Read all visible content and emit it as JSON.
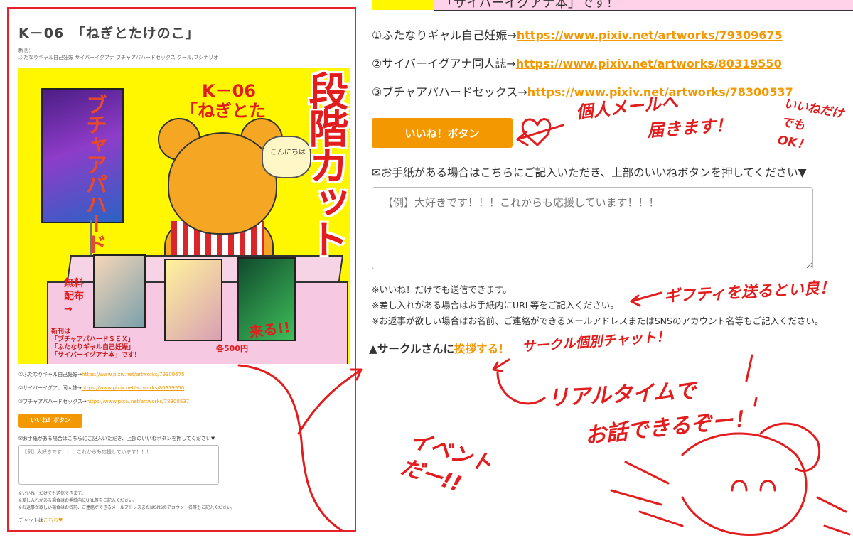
{
  "left_preview": {
    "title": "K－06　「ねぎとたけのこ」",
    "tags_heading": "新刊：",
    "tags": "ふたなりギャル自己妊娠 サイバーイグアナ ブチャアパハードセックス クール/フシナリオ",
    "poster": {
      "title_line1": "K－06",
      "title_line2": "「ねぎとた",
      "banner_text": "ブチャアパハード",
      "bubble_text": "こんにちは",
      "free_label": "無料\n配布\n→",
      "new_label": "新刊は\n「ブチャアパハードＳＥＸ」\n「ふたなりギャル自己妊娠」\n「サイバーイグアナ本」です！",
      "price_label": "各500円",
      "come_label": "来る!!"
    },
    "links": [
      {
        "label": "①ふたなりギャル自己妊娠→",
        "url": "https://www.pixiv.net/artworks/79309675"
      },
      {
        "label": "②サイバーイグアナ同人誌→",
        "url": "https://www.pixiv.net/artworks/80319550"
      },
      {
        "label": "③ブチャアパハードセックス→",
        "url": "https://www.pixiv.net/artworks/78300537"
      }
    ],
    "like_button": "いいね！ボタン",
    "letter_label": "✉お手紙がある場合はこちらにご記入いただき、上部のいいねボタンを押してください▼",
    "textarea_placeholder": "【例】大好きです！！！これからも応援しています！！！",
    "notes": [
      "※いいね！だけでも送信できます。",
      "※差し入れがある場合はお手紙内にURL等をご記入ください。",
      "※お返事が欲しい場合はお名前、ご連絡ができるメールアドレスまたはSNSのアカウント名等もご記入ください。"
    ],
    "chat_prefix": "チャットは",
    "chat_link": "こちら♥"
  },
  "annotation_left": "段階カット",
  "header_strip_text": "「サイバーイグアナ本」です！",
  "links": [
    {
      "label": "①ふたなりギャル自己妊娠→",
      "url": "https://www.pixiv.net/artworks/79309675"
    },
    {
      "label": "②サイバーイグアナ同人誌→",
      "url": "https://www.pixiv.net/artworks/80319550"
    },
    {
      "label": "③ブチャアパハードセックス→",
      "url": "https://www.pixiv.net/artworks/78300537"
    }
  ],
  "like_button": "いいね！ボタン",
  "letter_label": "✉お手紙がある場合はこちらにご記入いただき、上部のいいねボタンを押してください▼",
  "message_placeholder": "【例】大好きです！！！これからも応援しています！！！",
  "notes": [
    "※いいね！だけでも送信できます。",
    "※差し入れがある場合はお手紙内にURL等をご記入ください。",
    "※お返事が欲しい場合はお名前、ご連絡ができるメールアドレスまたはSNSのアカウント名等もご記入ください。"
  ],
  "circle": {
    "prefix": "▲サークルさんに",
    "link": "挨拶する！"
  },
  "annotations": {
    "personal_mail_1": "個人メールへ",
    "personal_mail_2": "届きます！",
    "ok": "いいねだけ\nでも\nOK！",
    "gift": "ギフティを送るとい良！",
    "circle_chat": "サークル個別チャット！",
    "realtime": "リアルタイムで",
    "talk": "お話できるぞー！",
    "event": "イベント\nだー!!"
  },
  "colors": {
    "accent_orange": "#f39800",
    "annotation_red": "#e31d1d",
    "poster_yellow": "#fff700",
    "header_pink": "#ffd2ea"
  }
}
